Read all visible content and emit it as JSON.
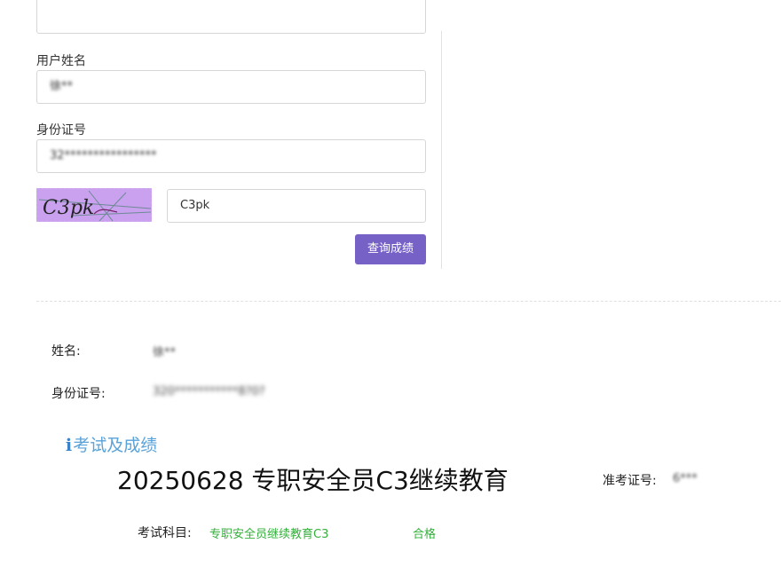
{
  "form": {
    "top_input_value": "",
    "name": {
      "label": "用户姓名",
      "value": "徐**"
    },
    "id_number": {
      "label": "身份证号",
      "value": "32****************"
    },
    "captcha": {
      "image_text": "C3pk",
      "input_value": "C3pk"
    },
    "query_button_label": "查询成绩"
  },
  "result": {
    "name_label": "姓名:",
    "name_value": "徐**",
    "id_label": "身份证号:",
    "id_value": "320***********8?0?",
    "section_title": "考试及成绩",
    "exam_title": "20250628 专职安全员C3继续教育",
    "admission_label": "准考证号:",
    "admission_value": "6***",
    "subject_label": "考试科目:",
    "subject_value": "专职安全员继续教育C3",
    "status": "合格"
  },
  "colors": {
    "primary_button": "#7661c6",
    "captcha_bg": "#c9a1ef",
    "section_title": "#5aa2d8",
    "pass_green": "#33b03a"
  },
  "icons": {
    "section_icon": "info-icon"
  }
}
